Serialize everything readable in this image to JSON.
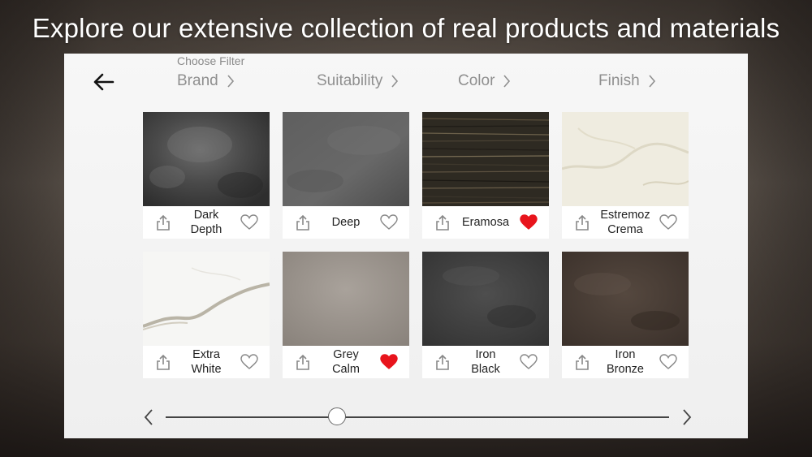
{
  "headline": "Explore our extensive collection of real products and materials",
  "filters": {
    "choose_label": "Choose Filter",
    "items": [
      {
        "label": "Brand"
      },
      {
        "label": "Suitability"
      },
      {
        "label": "Color"
      },
      {
        "label": "Finish"
      }
    ]
  },
  "colors": {
    "heart_active": "#e8141c",
    "heart_inactive": "#888888",
    "panel_bg": "#f6f6f6"
  },
  "products": [
    {
      "name_line1": "Dark",
      "name_line2": "Depth",
      "favorited": false,
      "swatch": "dark-depth"
    },
    {
      "name_line1": "Deep",
      "name_line2": "",
      "favorited": false,
      "swatch": "deep"
    },
    {
      "name_line1": "Eramosa",
      "name_line2": "",
      "favorited": true,
      "swatch": "eramosa"
    },
    {
      "name_line1": "Estremoz",
      "name_line2": "Crema",
      "favorited": false,
      "swatch": "estremoz-crema"
    },
    {
      "name_line1": "Extra",
      "name_line2": "White",
      "favorited": false,
      "swatch": "extra-white"
    },
    {
      "name_line1": "Grey",
      "name_line2": "Calm",
      "favorited": true,
      "swatch": "grey-calm"
    },
    {
      "name_line1": "Iron",
      "name_line2": "Black",
      "favorited": false,
      "swatch": "iron-black"
    },
    {
      "name_line1": "Iron",
      "name_line2": "Bronze",
      "favorited": false,
      "swatch": "iron-bronze"
    }
  ],
  "slider": {
    "position_fraction": 0.34
  },
  "icons": {
    "back": "arrow-left-icon",
    "chevron": "chevron-right-icon",
    "share": "share-icon",
    "heart": "heart-icon",
    "prev": "chevron-left-icon",
    "next": "chevron-right-icon"
  }
}
